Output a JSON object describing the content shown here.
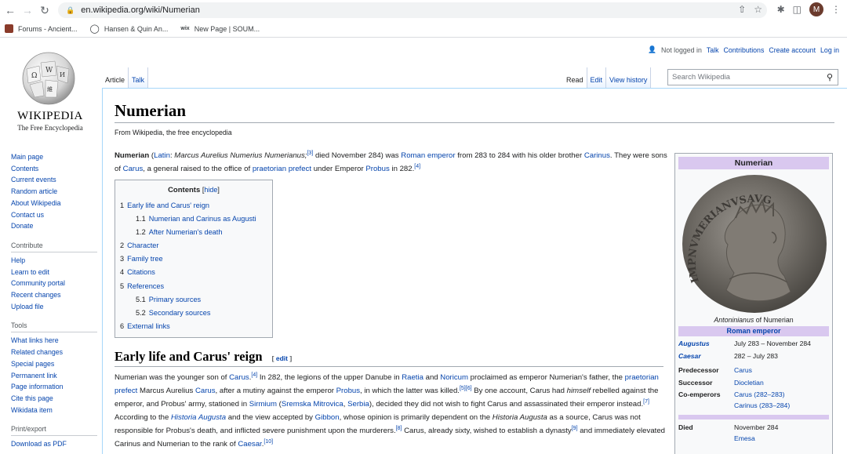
{
  "browser": {
    "url": "en.wikipedia.org/wiki/Numerian",
    "avatar_letter": "M",
    "bookmarks": [
      {
        "label": "Forums - Ancient...",
        "color": "#8a3b2a"
      },
      {
        "label": "Hansen & Quin An...",
        "color": "#3c4043"
      },
      {
        "label": "New Page | SOUM...",
        "prefix": "wix",
        "color": "#000000"
      }
    ]
  },
  "wiki": {
    "wordmark": "Wikipedia",
    "wordmark_tagline": "The Free Encyclopedia",
    "nav_main": [
      "Main page",
      "Contents",
      "Current events",
      "Random article",
      "About Wikipedia",
      "Contact us",
      "Donate"
    ],
    "contribute_heading": "Contribute",
    "nav_contribute": [
      "Help",
      "Learn to edit",
      "Community portal",
      "Recent changes",
      "Upload file"
    ],
    "tools_heading": "Tools",
    "nav_tools": [
      "What links here",
      "Related changes",
      "Special pages",
      "Permanent link",
      "Page information",
      "Cite this page",
      "Wikidata item"
    ],
    "print_heading": "Print/export",
    "nav_print": [
      "Download as PDF"
    ],
    "personal": {
      "not_logged_in": "Not logged in",
      "talk": "Talk",
      "contributions": "Contributions",
      "create_account": "Create account",
      "log_in": "Log in"
    },
    "tabs_left": [
      "Article",
      "Talk"
    ],
    "tabs_right": [
      "Read",
      "Edit",
      "View history"
    ],
    "search_placeholder": "Search Wikipedia"
  },
  "article": {
    "title": "Numerian",
    "tagline": "From Wikipedia, the free encyclopedia",
    "toc": {
      "title": "Contents",
      "hide": "hide",
      "items": [
        {
          "num": "1",
          "label": "Early life and Carus' reign",
          "sub": false
        },
        {
          "num": "1.1",
          "label": "Numerian and Carinus as Augusti",
          "sub": true
        },
        {
          "num": "1.2",
          "label": "After Numerian's death",
          "sub": true
        },
        {
          "num": "2",
          "label": "Character",
          "sub": false
        },
        {
          "num": "3",
          "label": "Family tree",
          "sub": false
        },
        {
          "num": "4",
          "label": "Citations",
          "sub": false
        },
        {
          "num": "5",
          "label": "References",
          "sub": false
        },
        {
          "num": "5.1",
          "label": "Primary sources",
          "sub": true
        },
        {
          "num": "5.2",
          "label": "Secondary sources",
          "sub": true
        },
        {
          "num": "6",
          "label": "External links",
          "sub": false
        }
      ]
    },
    "section1_heading": "Early life and Carus' reign",
    "edit_label": "edit"
  },
  "infobox": {
    "title": "Numerian",
    "caption_italic": "Antoninianus",
    "caption_rest": " of Numerian",
    "coin_inscription": "IMPNVMERIANVSAVG",
    "section": "Roman emperor",
    "rows": [
      {
        "label": "Augustus",
        "value": "July 283 – November 284",
        "italic": true
      },
      {
        "label": "Caesar",
        "value": "282 – July 283",
        "italic": true
      },
      {
        "label": "Predecessor",
        "value": "Carus",
        "link": true
      },
      {
        "label": "Successor",
        "value": "Diocletian",
        "link": true
      },
      {
        "label": "Co-emperors",
        "value": "Carus (282–283)",
        "value2": "Carinus (283–284)",
        "link": true
      }
    ],
    "died_label": "Died",
    "died_value": "November 284",
    "died_place": "Emesa"
  }
}
